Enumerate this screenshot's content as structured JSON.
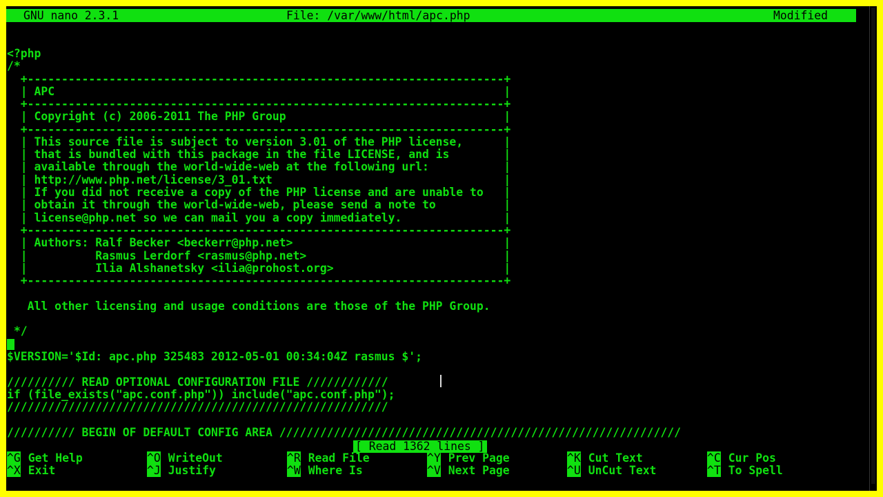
{
  "title_bar": {
    "app": "GNU nano 2.3.1",
    "file": "File: /var/www/html/apc.php",
    "status": "Modified"
  },
  "editor_lines": [
    "<?php",
    "/*",
    "  +----------------------------------------------------------------------+",
    "  | APC                                                                  |",
    "  +----------------------------------------------------------------------+",
    "  | Copyright (c) 2006-2011 The PHP Group                                |",
    "  +----------------------------------------------------------------------+",
    "  | This source file is subject to version 3.01 of the PHP license,      |",
    "  | that is bundled with this package in the file LICENSE, and is        |",
    "  | available through the world-wide-web at the following url:           |",
    "  | http://www.php.net/license/3_01.txt                                  |",
    "  | If you did not receive a copy of the PHP license and are unable to   |",
    "  | obtain it through the world-wide-web, please send a note to          |",
    "  | license@php.net so we can mail you a copy immediately.               |",
    "  +----------------------------------------------------------------------+",
    "  | Authors: Ralf Becker <beckerr@php.net>                               |",
    "  |          Rasmus Lerdorf <rasmus@php.net>                             |",
    "  |          Ilia Alshanetsky <ilia@prohost.org>                         |",
    "  +----------------------------------------------------------------------+",
    "",
    "   All other licensing and usage conditions are those of the PHP Group.",
    "",
    " */",
    "",
    "$VERSION='$Id: apc.php 325483 2012-05-01 00:34:04Z rasmus $';",
    "",
    "////////// READ OPTIONAL CONFIGURATION FILE ////////////",
    "if (file_exists(\"apc.conf.php\")) include(\"apc.conf.php\");",
    "////////////////////////////////////////////////////////",
    "",
    "////////// BEGIN OF DEFAULT CONFIG AREA ///////////////////////////////////////////////////////////"
  ],
  "status_message": "[ Read 1362 lines ]",
  "shortcuts": [
    {
      "key": "^G",
      "label": "Get Help"
    },
    {
      "key": "^X",
      "label": "Exit"
    },
    {
      "key": "^O",
      "label": "WriteOut"
    },
    {
      "key": "^J",
      "label": "Justify"
    },
    {
      "key": "^R",
      "label": "Read File"
    },
    {
      "key": "^W",
      "label": "Where Is"
    },
    {
      "key": "^Y",
      "label": "Prev Page"
    },
    {
      "key": "^V",
      "label": "Next Page"
    },
    {
      "key": "^K",
      "label": "Cut Text"
    },
    {
      "key": "^U",
      "label": "UnCut Text"
    },
    {
      "key": "^C",
      "label": "Cur Pos"
    },
    {
      "key": "^T",
      "label": "To Spell"
    }
  ],
  "colors": {
    "frame": "#ffff00",
    "text": "#10e010",
    "background": "#000000"
  }
}
